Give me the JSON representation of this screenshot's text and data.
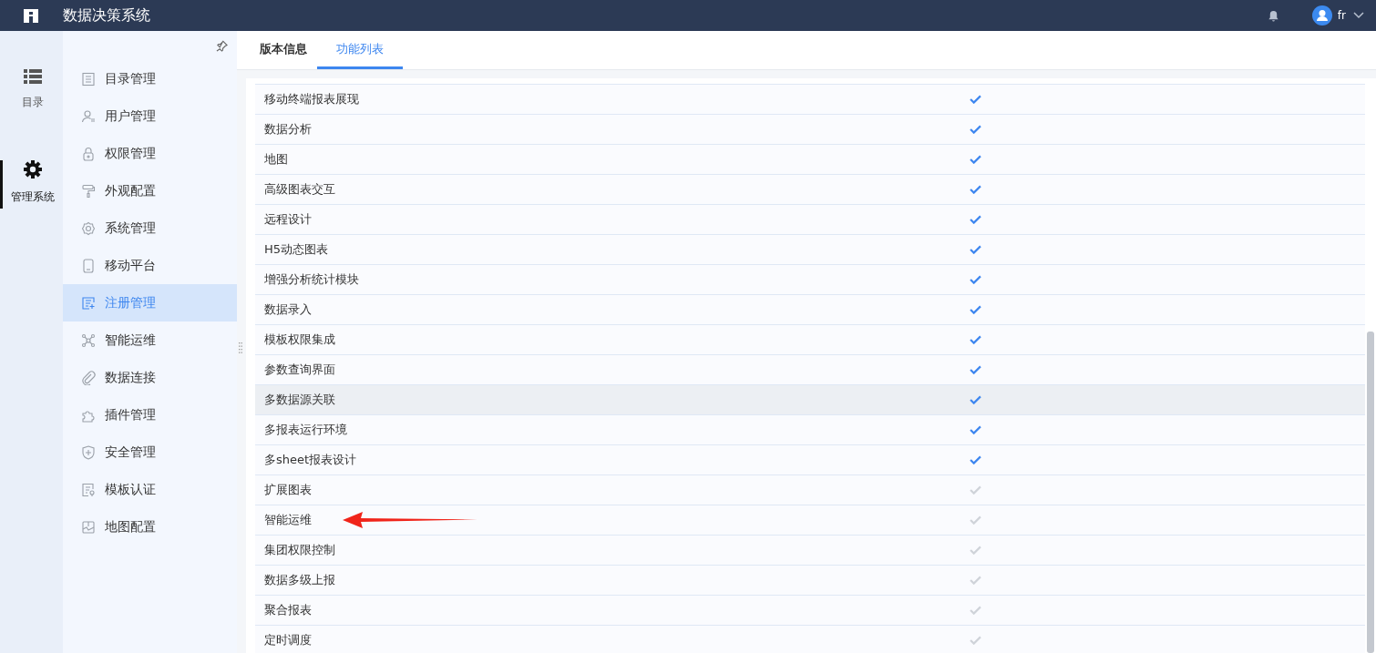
{
  "header": {
    "title": "数据决策系统",
    "user": "fr"
  },
  "rail": [
    {
      "label": "目录",
      "kind": "list",
      "selected": false
    },
    {
      "label": "管理系统",
      "kind": "gear",
      "selected": true
    }
  ],
  "menu": [
    {
      "label": "目录管理",
      "kind": "catalog",
      "selected": false
    },
    {
      "label": "用户管理",
      "kind": "user",
      "selected": false
    },
    {
      "label": "权限管理",
      "kind": "lock",
      "selected": false
    },
    {
      "label": "外观配置",
      "kind": "roller",
      "selected": false
    },
    {
      "label": "系统管理",
      "kind": "gear",
      "selected": false
    },
    {
      "label": "移动平台",
      "kind": "phone",
      "selected": false
    },
    {
      "label": "注册管理",
      "kind": "register",
      "selected": true
    },
    {
      "label": "智能运维",
      "kind": "nodes",
      "selected": false
    },
    {
      "label": "数据连接",
      "kind": "clip",
      "selected": false
    },
    {
      "label": "插件管理",
      "kind": "puzzle",
      "selected": false
    },
    {
      "label": "安全管理",
      "kind": "shield",
      "selected": false
    },
    {
      "label": "模板认证",
      "kind": "doc",
      "selected": false
    },
    {
      "label": "地图配置",
      "kind": "map",
      "selected": false
    }
  ],
  "tabs": [
    {
      "label": "版本信息",
      "selected": false
    },
    {
      "label": "功能列表",
      "selected": true
    }
  ],
  "features": [
    {
      "name": "移动终端报表展现",
      "checked": true,
      "hovered": false,
      "marked": false
    },
    {
      "name": "数据分析",
      "checked": true,
      "hovered": false,
      "marked": false
    },
    {
      "name": "地图",
      "checked": true,
      "hovered": false,
      "marked": false
    },
    {
      "name": "高级图表交互",
      "checked": true,
      "hovered": false,
      "marked": false
    },
    {
      "name": "远程设计",
      "checked": true,
      "hovered": false,
      "marked": false
    },
    {
      "name": "H5动态图表",
      "checked": true,
      "hovered": false,
      "marked": false
    },
    {
      "name": "增强分析统计模块",
      "checked": true,
      "hovered": false,
      "marked": false
    },
    {
      "name": "数据录入",
      "checked": true,
      "hovered": false,
      "marked": false
    },
    {
      "name": "模板权限集成",
      "checked": true,
      "hovered": false,
      "marked": false
    },
    {
      "name": "参数查询界面",
      "checked": true,
      "hovered": false,
      "marked": false
    },
    {
      "name": "多数据源关联",
      "checked": true,
      "hovered": true,
      "marked": false
    },
    {
      "name": "多报表运行环境",
      "checked": true,
      "hovered": false,
      "marked": false
    },
    {
      "name": "多sheet报表设计",
      "checked": true,
      "hovered": false,
      "marked": false
    },
    {
      "name": "扩展图表",
      "checked": false,
      "hovered": false,
      "marked": false
    },
    {
      "name": "智能运维",
      "checked": false,
      "hovered": false,
      "marked": true
    },
    {
      "name": "集团权限控制",
      "checked": false,
      "hovered": false,
      "marked": false
    },
    {
      "name": "数据多级上报",
      "checked": false,
      "hovered": false,
      "marked": false
    },
    {
      "name": "聚合报表",
      "checked": false,
      "hovered": false,
      "marked": false
    },
    {
      "name": "定时调度",
      "checked": false,
      "hovered": false,
      "marked": false
    }
  ]
}
